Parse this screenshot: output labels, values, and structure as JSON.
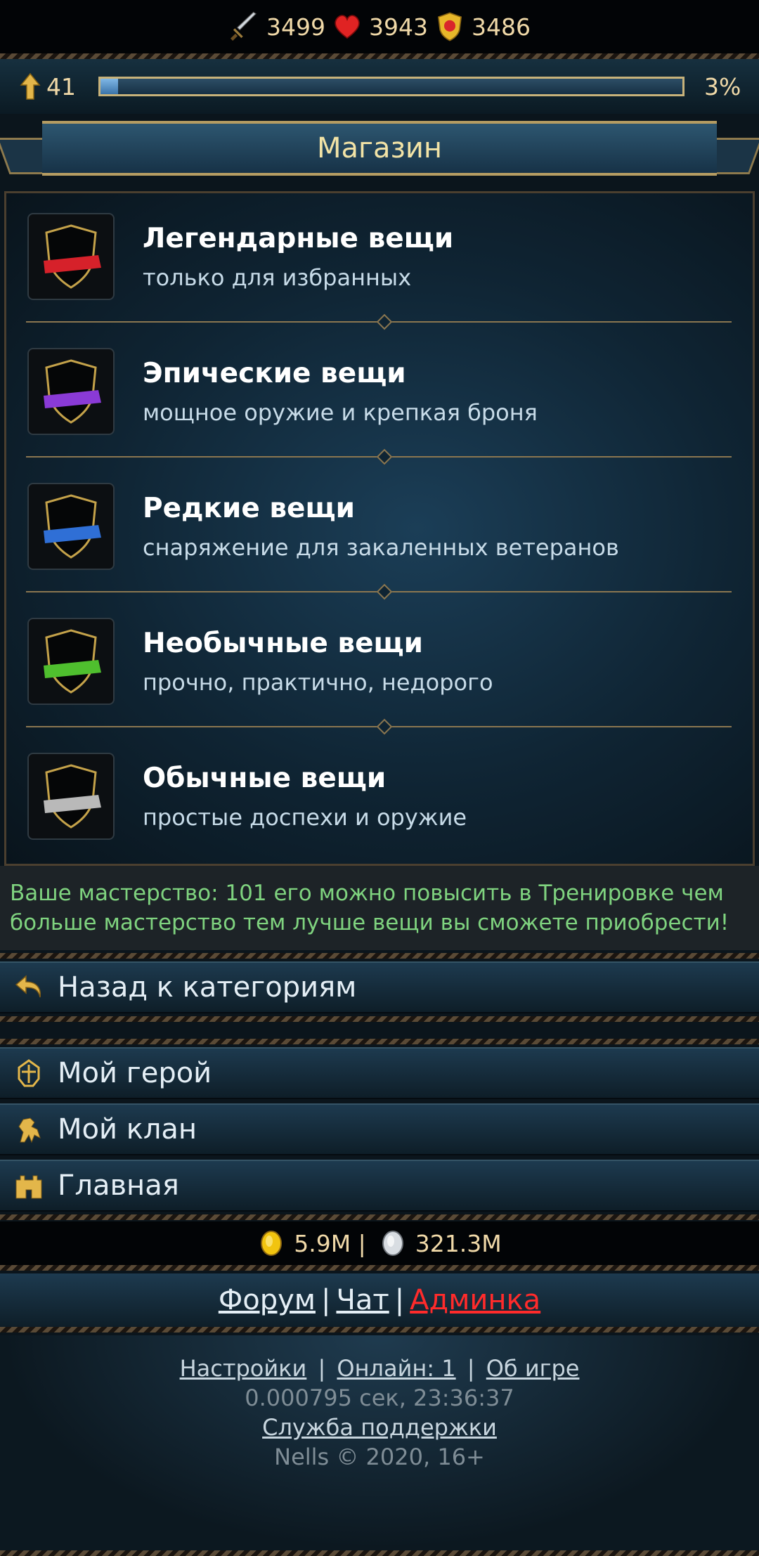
{
  "stats": {
    "attack": "3499",
    "health": "3943",
    "defense": "3486"
  },
  "level": {
    "value": "41",
    "progress": 0.03,
    "percent_label": "3%"
  },
  "page_title": "Магазин",
  "shop_items": [
    {
      "title": "Легендарные вещи",
      "desc": "только для избранных",
      "ribbon_color": "#d6212a"
    },
    {
      "title": "Эпические вещи",
      "desc": "мощное оружие и крепкая броня",
      "ribbon_color": "#8a3ad6"
    },
    {
      "title": "Редкие вещи",
      "desc": "снаряжение для закаленных ветеранов",
      "ribbon_color": "#2f6fd6"
    },
    {
      "title": "Необычные вещи",
      "desc": "прочно, практично, недорого",
      "ribbon_color": "#4fbf2e"
    },
    {
      "title": "Обычные вещи",
      "desc": "простые доспехи и оружие",
      "ribbon_color": "#b9b9b9"
    }
  ],
  "mastery_text": "Ваше мастерство: 101 его можно повысить в Тренировке чем больше мастерство тем лучше вещи вы сможете приобрести!",
  "nav": {
    "back": "Назад к категориям",
    "hero": "Мой герой",
    "clan": "Мой клан",
    "home": "Главная"
  },
  "money": {
    "gold": "5.9M |",
    "silver": "321.3M"
  },
  "links": {
    "forum": "Форум ",
    "chat": "Чат ",
    "admin": "Админка",
    "sep": "|"
  },
  "footer": {
    "settings": "Настройки",
    "online": "Онлайн: 1",
    "about": "Об игре",
    "sep": "|",
    "timing": "0.000795 сек, 23:36:37",
    "support": "Служба поддержки",
    "copyright": "Nells © 2020, 16+"
  },
  "icons": {
    "stats": [
      "sword-icon",
      "heart-icon",
      "shield-icon"
    ],
    "level": "arrow-up-icon",
    "nav": [
      "back-arrow-icon",
      "hero-helmet-icon",
      "clan-lion-icon",
      "castle-icon"
    ],
    "money": [
      "gold-coin-icon",
      "silver-coin-icon"
    ]
  }
}
